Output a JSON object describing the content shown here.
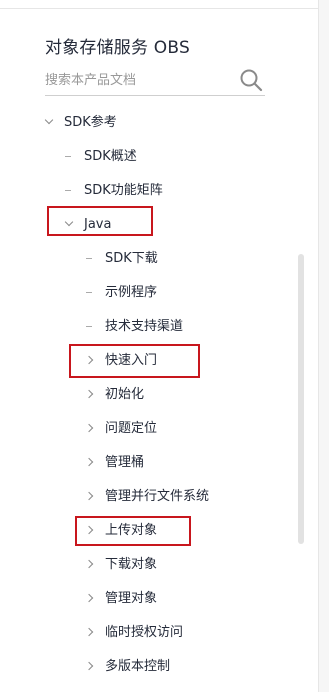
{
  "sidebar": {
    "title": "对象存储服务 OBS",
    "search_placeholder": "搜索本产品文档",
    "items": [
      {
        "label": "SDK参考"
      },
      {
        "label": "SDK概述"
      },
      {
        "label": "SDK功能矩阵"
      },
      {
        "label": "Java"
      },
      {
        "label": "SDK下载"
      },
      {
        "label": "示例程序"
      },
      {
        "label": "技术支持渠道"
      },
      {
        "label": "快速入门"
      },
      {
        "label": "初始化"
      },
      {
        "label": "问题定位"
      },
      {
        "label": "管理桶"
      },
      {
        "label": "管理并行文件系统"
      },
      {
        "label": "上传对象"
      },
      {
        "label": "下载对象"
      },
      {
        "label": "管理对象"
      },
      {
        "label": "临时授权访问"
      },
      {
        "label": "多版本控制"
      }
    ]
  },
  "colors": {
    "highlight": "#c8161d",
    "text": "#252b3a",
    "muted": "#999999"
  }
}
